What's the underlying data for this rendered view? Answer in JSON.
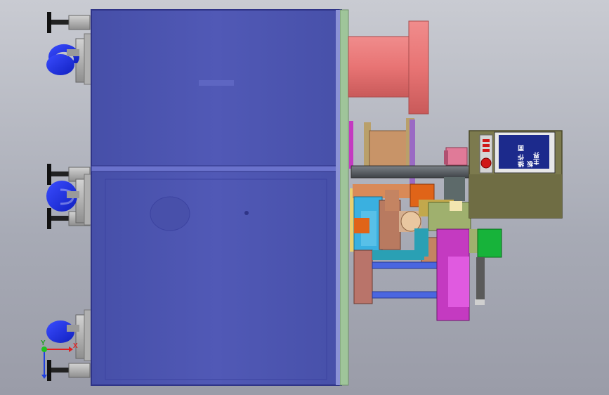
{
  "viewport": {
    "background_top": "#c9cbd2",
    "background_bottom": "#9a9ca8"
  },
  "colors": {
    "cabinet": "#4f56b0",
    "cabinet_edge": "#2f3487",
    "roller": "#e87474",
    "hmi_body": "#7c7a4e",
    "hmi_screen": "#1c2a8c",
    "caster": "#1f2de0",
    "frame_plate": "#9fc59a",
    "magenta": "#c43ac1",
    "teal": "#2aa0b4",
    "green_box": "#17b33a",
    "orange": "#e06418",
    "brown": "#b9746a"
  },
  "hmi": {
    "screen_line_1": "操作 面板",
    "screen_line_2": "主界"
  },
  "axes": {
    "x_label": "X",
    "y_label": "Y",
    "x_color": "#e02020",
    "y_color": "#20c020",
    "z_color": "#2040e0"
  },
  "icons": {
    "casters": "caster-wheel-icon",
    "leveling_feet": "leveling-foot-icon",
    "emergency_stop": "emergency-stop-icon",
    "triad": "coordinate-triad-icon"
  }
}
